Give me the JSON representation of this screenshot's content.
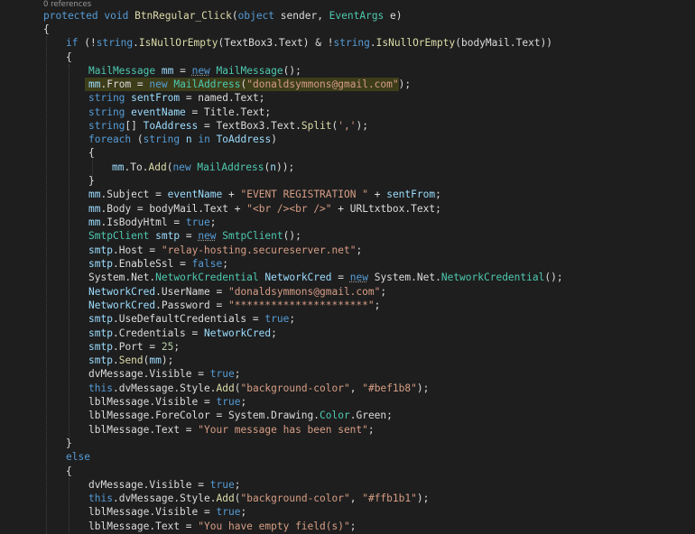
{
  "codelens": "0 references",
  "lines": [
    "protected void BtnRegular_Click(object sender, EventArgs e)",
    "{",
    "if (!string.IsNullOrEmpty(TextBox3.Text) & !string.IsNullOrEmpty(bodyMail.Text))",
    "{",
    "MailMessage mm = new MailMessage();",
    "mm.From = new MailAddress(\"donaldsymmons@gmail.com\");",
    "string sentFrom = named.Text;",
    "string eventName = Title.Text;",
    "string[] ToAddress = TextBox3.Text.Split(',');",
    "foreach (string n in ToAddress)",
    "{",
    "mm.To.Add(new MailAddress(n));",
    "}",
    "mm.Subject = eventName + \"EVENT REGISTRATION \" + sentFrom;",
    "mm.Body = bodyMail.Text + \"<br /><br />\" + URLtxtbox.Text;",
    "mm.IsBodyHtml = true;",
    "SmtpClient smtp = new SmtpClient();",
    "smtp.Host = \"relay-hosting.secureserver.net\";",
    "smtp.EnableSsl = false;",
    "System.Net.NetworkCredential NetworkCred = new System.Net.NetworkCredential();",
    "NetworkCred.UserName = \"donaldsymmons@gmail.com\";",
    "NetworkCred.Password = \"**********************\";",
    "smtp.UseDefaultCredentials = true;",
    "smtp.Credentials = NetworkCred;",
    "smtp.Port = 25;",
    "smtp.Send(mm);",
    "dvMessage.Visible = true;",
    "this.dvMessage.Style.Add(\"background-color\", \"#bef1b8\");",
    "lblMessage.Visible = true;",
    "lblMessage.ForeColor = System.Drawing.Color.Green;",
    "lblMessage.Text = \"Your message has been sent\";",
    "}",
    "else",
    "{",
    "dvMessage.Visible = true;",
    "this.dvMessage.Style.Add(\"background-color\", \"#ffb1b1\");",
    "lblMessage.Visible = true;",
    "lblMessage.Text = \"You have empty field(s)\";"
  ]
}
